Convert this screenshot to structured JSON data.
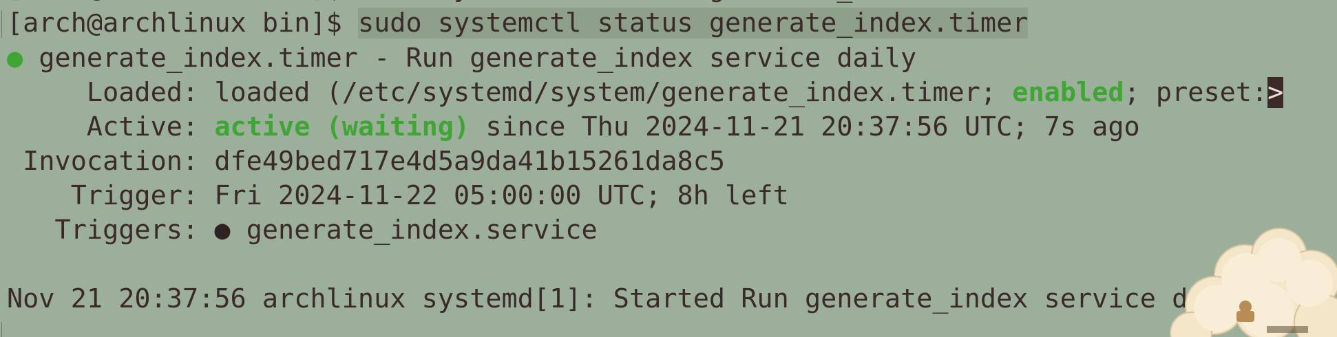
{
  "terminal": {
    "cut_off_text": "[arch@archlinux bin]$ sudo systemctl status generate_index.timer",
    "prompt": "[arch@archlinux bin]$ ",
    "command": "sudo systemctl status generate_index.timer",
    "unit_line": {
      "bullet": "●",
      "text": " generate_index.timer - Run generate_index service daily"
    },
    "loaded": {
      "label": "     Loaded: ",
      "value_before": "loaded (/etc/systemd/system/generate_index.timer; ",
      "enabled": "enabled",
      "value_after": "; preset:",
      "overflow_marker": ">"
    },
    "active": {
      "label": "     Active: ",
      "state": "active (waiting)",
      "since": " since Thu 2024-11-21 20:37:56 UTC; 7s ago"
    },
    "invocation": {
      "label": " Invocation: ",
      "value": "dfe49bed717e4d5a9da41b15261da8c5"
    },
    "trigger": {
      "label": "    Trigger: ",
      "value": "Fri 2024-11-22 05:00:00 UTC; 8h left"
    },
    "triggers": {
      "label": "   Triggers: ",
      "bullet": "●",
      "value": " generate_index.service"
    },
    "log_line": "Nov 21 20:37:56 archlinux systemd[1]: Started Run generate_index service daily."
  },
  "colors": {
    "background": "#9caf9a",
    "text": "#3b2a2a",
    "accent_green": "#3fa534",
    "command_highlight": "#8e9f8a"
  }
}
